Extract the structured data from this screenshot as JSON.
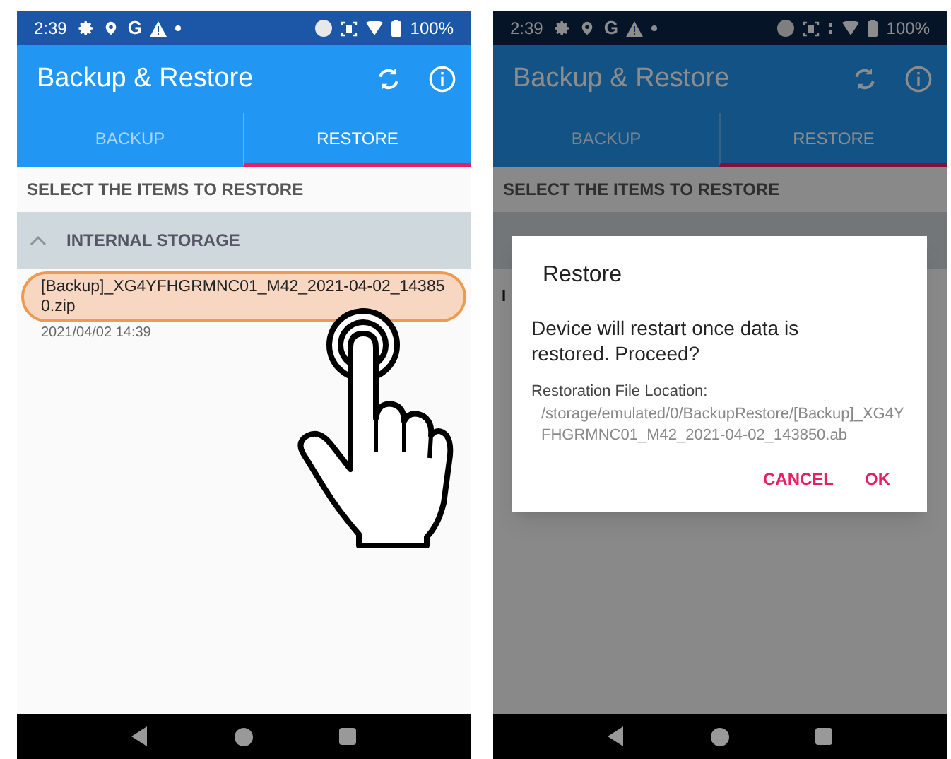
{
  "screens": [
    {
      "status_bar": {
        "time": "2:39",
        "google_glyph": "G",
        "battery": "100%",
        "vibrate": false
      },
      "app_bar": {
        "title": "Backup & Restore"
      },
      "tabs": [
        {
          "label": "BACKUP",
          "selected": false
        },
        {
          "label": "RESTORE",
          "selected": true
        }
      ],
      "prompt": "SELECT THE ITEMS TO RESTORE",
      "group": {
        "label": "INTERNAL STORAGE",
        "expanded": true
      },
      "items": [
        {
          "name": "[Backup]_XG4YFHGRMNC01_M42_2021-04-02_143850.zip",
          "date": "2021/04/02 14:39",
          "highlighted": true
        }
      ],
      "tap_gesture": true,
      "dimmed": false
    },
    {
      "status_bar": {
        "time": "2:39",
        "google_glyph": "G",
        "battery": "100%",
        "vibrate": true
      },
      "app_bar": {
        "title": "Backup & Restore"
      },
      "tabs": [
        {
          "label": "BACKUP",
          "selected": false
        },
        {
          "label": "RESTORE",
          "selected": true
        }
      ],
      "prompt": "SELECT THE ITEMS TO RESTORE",
      "partial_item": "I",
      "tap_gesture": false,
      "dimmed": true,
      "dialog": {
        "title": "Restore",
        "message": "Device will restart once data is restored. Proceed?",
        "location_label": "Restoration File Location:",
        "location": "/storage/emulated/0/BackupRestore/[Backup]_XG4YFHGRMNC01_M42_2021-04-02_143850.ab",
        "buttons": [
          "CANCEL",
          "OK"
        ]
      }
    }
  ]
}
